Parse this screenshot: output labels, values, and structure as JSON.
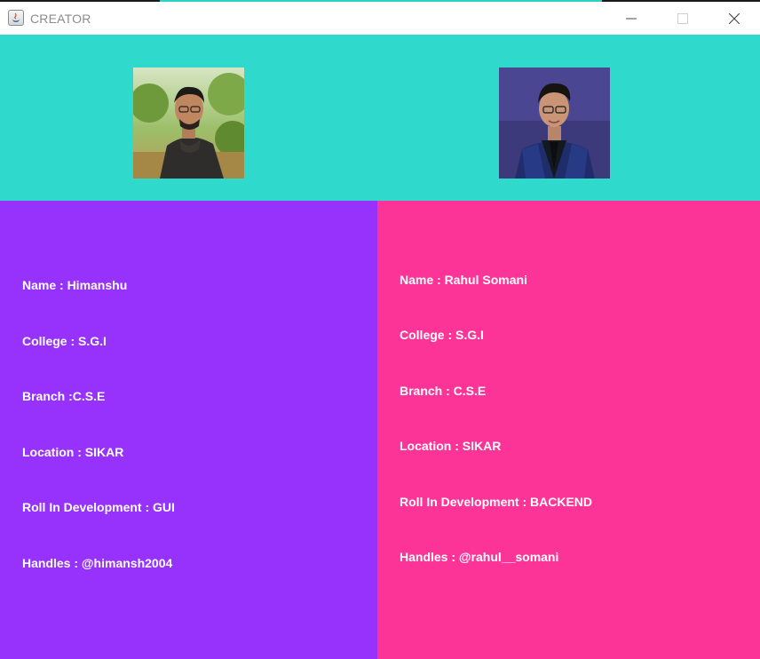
{
  "window": {
    "title": "CREATOR",
    "icon": "java-app-icon",
    "controls": [
      "minimize-icon",
      "maximize-icon",
      "close-icon"
    ]
  },
  "colors": {
    "header": "#2fd9cb",
    "left_panel": "#9632fc",
    "right_panel": "#fd3497",
    "text": "#ffffff"
  },
  "creators": [
    {
      "photo": "person-photo-outdoor",
      "name": "Name : Himanshu",
      "college": "College : S.G.I",
      "branch": "Branch :C.S.E",
      "location": "Location : SIKAR",
      "role": "Roll In Development : GUI",
      "handles": "Handles : @himansh2004"
    },
    {
      "photo": "person-photo-formal",
      "name": "Name : Rahul Somani",
      "college": "College : S.G.I",
      "branch": "Branch : C.S.E",
      "location": "Location : SIKAR",
      "role": "Roll In Development : BACKEND",
      "handles": "Handles : @rahul__somani"
    }
  ]
}
